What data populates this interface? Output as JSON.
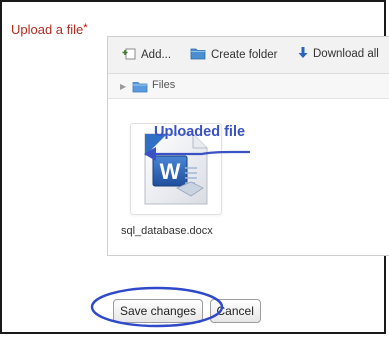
{
  "form": {
    "label": "Upload a file",
    "required_marker": "*"
  },
  "toolbar": {
    "add_label": "Add...",
    "create_folder_label": "Create folder",
    "download_all_label": "Download all"
  },
  "path": {
    "folder_label": "Files"
  },
  "file": {
    "name": "sql_database.docx",
    "icon": "word-document-icon"
  },
  "annotation": {
    "text": "Uploaded file",
    "color": "#3a52c4"
  },
  "actions": {
    "save_label": "Save changes",
    "cancel_label": "Cancel"
  }
}
